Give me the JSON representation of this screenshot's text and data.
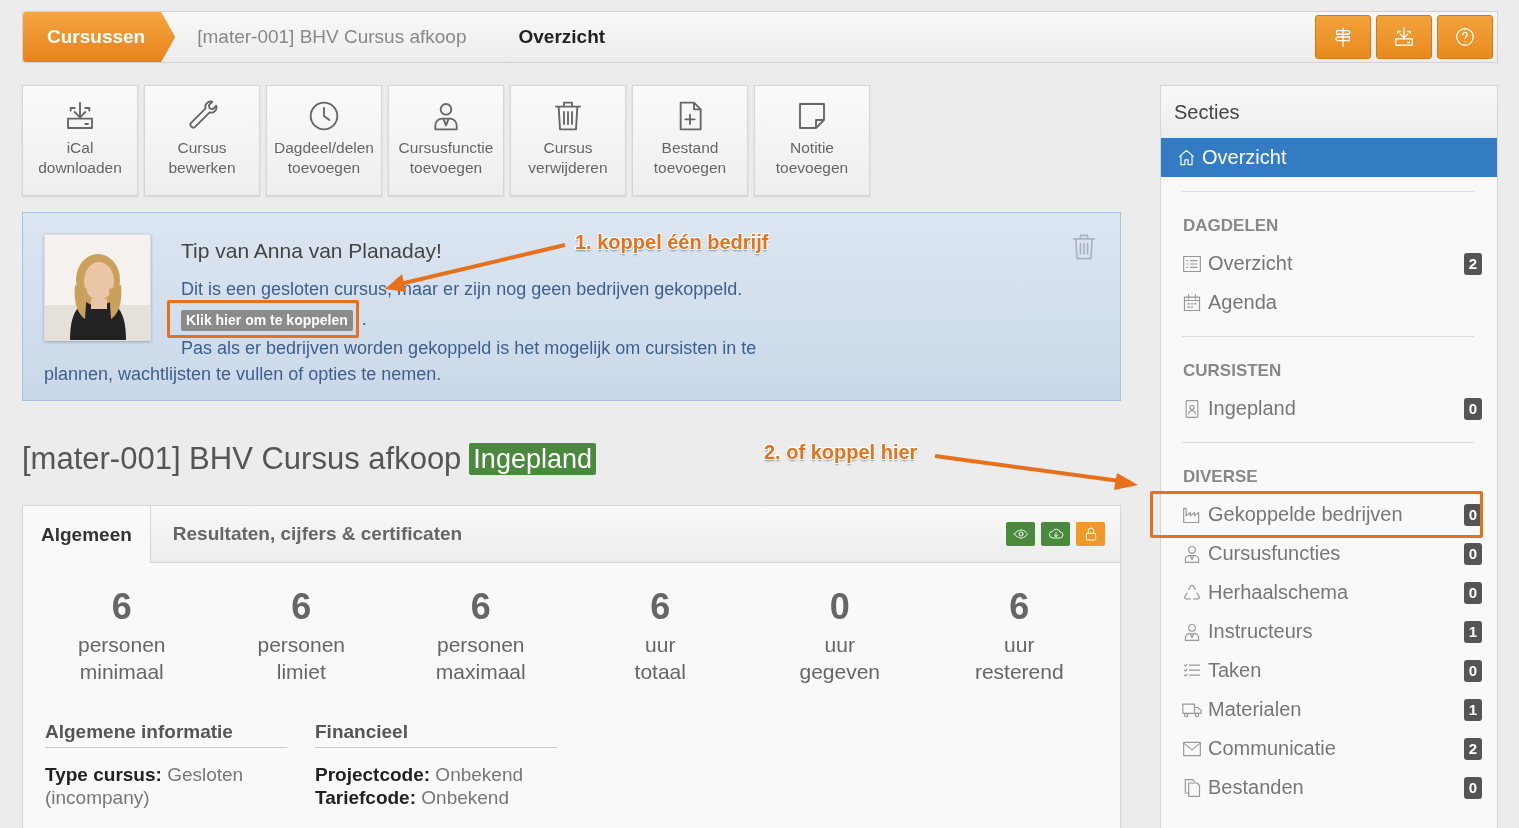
{
  "breadcrumb": [
    {
      "label": "Cursussen",
      "kind": "root"
    },
    {
      "label": "[mater-001] BHV Cursus afkoop",
      "kind": "link"
    },
    {
      "label": "Overzicht",
      "kind": "current"
    }
  ],
  "header_buttons": [
    {
      "kind": "signpost"
    },
    {
      "kind": "download"
    },
    {
      "kind": "help"
    }
  ],
  "actions": [
    {
      "label": "iCal downloaden",
      "kind": "download"
    },
    {
      "label": "Cursus bewerken",
      "kind": "wrench"
    },
    {
      "label": "Dagdeel/delen toevoegen",
      "kind": "clock"
    },
    {
      "label": "Cursusfunctie toevoegen",
      "kind": "person"
    },
    {
      "label": "Cursus verwijderen",
      "kind": "trash"
    },
    {
      "label": "Bestand toevoegen",
      "kind": "file"
    },
    {
      "label": "Notitie toevoegen",
      "kind": "note"
    }
  ],
  "tip": {
    "title": "Tip van Anna van Planaday!",
    "text": "Dit is een gesloten cursus, maar er zijn nog geen bedrijven gekoppeld.",
    "link": {
      "label": "Klik hier om te koppelen",
      "highlighted": true
    },
    "link_suffix": ".",
    "text_2": "Pas als er bedrijven worden gekoppeld is het mogelijk om cursisten in te plannen, wachtlijsten te vullen of opties te nemen."
  },
  "course": {
    "title": "[mater-001] BHV Cursus afkoop",
    "status": "Ingepland"
  },
  "tabs": [
    {
      "label": "Algemeen",
      "selected": true
    },
    {
      "label": "Resultaten, cijfers & certificaten",
      "selected": false
    }
  ],
  "tab_buttons": [
    {
      "kind": "eye",
      "color": "#4a8a3c"
    },
    {
      "kind": "cloud",
      "color": "#4a8a3c"
    },
    {
      "kind": "lock",
      "color": "#f0992a"
    }
  ],
  "stats": [
    {
      "value": "6",
      "unit": "personen",
      "label": "minimaal"
    },
    {
      "value": "6",
      "unit": "personen",
      "label": "limiet"
    },
    {
      "value": "6",
      "unit": "personen",
      "label": "maximaal"
    },
    {
      "value": "6",
      "unit": "uur",
      "label": "totaal"
    },
    {
      "value": "0",
      "unit": "uur",
      "label": "gegeven"
    },
    {
      "value": "6",
      "unit": "uur",
      "label": "resterend"
    }
  ],
  "info_sections": [
    {
      "title": "Algemene informatie",
      "rows": [
        {
          "label": "Type cursus:",
          "value": "Gesloten (incompany)"
        }
      ]
    },
    {
      "title": "Financieel",
      "rows": [
        {
          "label": "Projectcode:",
          "value": "Onbekend"
        },
        {
          "label": "Tariefcode:",
          "value": "Onbekend"
        }
      ]
    }
  ],
  "sidebar": {
    "title": "Secties",
    "active_item": {
      "label": "Overzicht",
      "selected": true
    },
    "groups": [
      {
        "heading": "DAGDELEN",
        "items": [
          {
            "label": "Overzicht",
            "kind": "list",
            "count": "2"
          },
          {
            "label": "Agenda",
            "kind": "calendar"
          }
        ]
      },
      {
        "heading": "CURSISTEN",
        "items": [
          {
            "label": "Ingepland",
            "kind": "badge",
            "count": "0"
          }
        ]
      },
      {
        "heading": "DIVERSE",
        "items": [
          {
            "label": "Gekoppelde bedrijven",
            "kind": "factory",
            "count": "0",
            "highlighted": true
          },
          {
            "label": "Cursusfuncties",
            "kind": "person",
            "count": "0"
          },
          {
            "label": "Herhaalschema",
            "kind": "recycle",
            "count": "0"
          },
          {
            "label": "Instructeurs",
            "kind": "person",
            "count": "1"
          },
          {
            "label": "Taken",
            "kind": "tasks",
            "count": "0"
          },
          {
            "label": "Materialen",
            "kind": "truck",
            "count": "1"
          },
          {
            "label": "Communicatie",
            "kind": "mail",
            "count": "2"
          },
          {
            "label": "Bestanden",
            "kind": "files",
            "count": "0"
          }
        ]
      }
    ]
  },
  "annotations": [
    {
      "text": "1. koppel één bedrijf"
    },
    {
      "text": "2. of koppel hier"
    }
  ]
}
